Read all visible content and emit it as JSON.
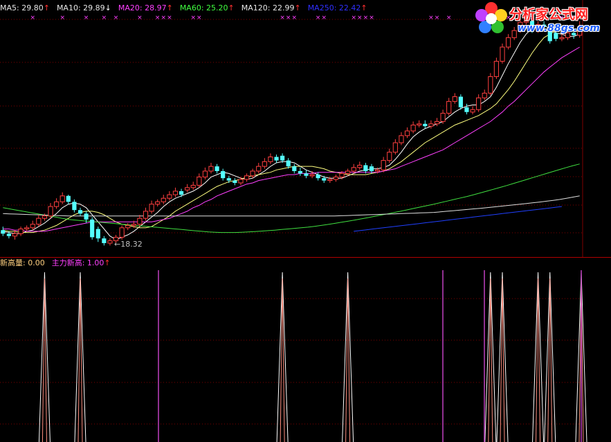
{
  "logo": {
    "title": "分析家公式网",
    "url": "www.88gs.com"
  },
  "legend_top": [
    {
      "label": "MA5: 29.80",
      "color": "#e6e6e6",
      "arrow": "↑",
      "arrow_dir": "up"
    },
    {
      "label": "MA10: 29.89",
      "color": "#e6e6e6",
      "arrow": "↓",
      "arrow_dir": "down"
    },
    {
      "label": "MA20: 28.97",
      "color": "#ff40ff",
      "arrow": "↑",
      "arrow_dir": "up"
    },
    {
      "label": "MA60: 25.20",
      "color": "#40ff40",
      "arrow": "↑",
      "arrow_dir": "up"
    },
    {
      "label": "MA120: 22.99",
      "color": "#e6e6e6",
      "arrow": "↑",
      "arrow_dir": "up"
    },
    {
      "label": "MA250: 22.42",
      "color": "#3030ff",
      "arrow": "↑",
      "arrow_dir": "up"
    }
  ],
  "legend_bottom": [
    {
      "label": "新高量: 0.00",
      "color": "#ffd080",
      "arrow": "",
      "arrow_dir": ""
    },
    {
      "label": "主力新高: 1.00",
      "color": "#ff40ff",
      "arrow": "↑",
      "arrow_dir": "up"
    }
  ],
  "low_label": "←18.32",
  "colors": {
    "up": "#ff4040",
    "down": "#54ffff",
    "ma5": "#ffffff",
    "ma10": "#ffff80",
    "ma20": "#ff40ff",
    "ma60": "#40e040",
    "ma120": "#e0e0e0",
    "ma250": "#2040ff",
    "grid": "#800000",
    "indicator_peak": "#ff9080",
    "indicator_line": "#ffffff",
    "indicator_bar": "#c040c0"
  },
  "chart_data": {
    "type": "line",
    "candles": {
      "open": [
        19.6,
        19.3,
        19.1,
        19.3,
        19.7,
        19.8,
        20.1,
        20.6,
        20.8,
        21.6,
        22.0,
        22.5,
        22.0,
        21.3,
        21.0,
        20.5,
        19.7,
        18.9,
        18.5,
        18.7,
        19.0,
        19.8,
        20.0,
        20.1,
        20.6,
        21.2,
        21.8,
        22.0,
        22.3,
        22.6,
        22.9,
        23.0,
        23.2,
        23.4,
        24.1,
        24.6,
        25.0,
        24.6,
        24.0,
        23.8,
        23.6,
        23.9,
        24.2,
        24.6,
        25.0,
        25.4,
        25.8,
        25.9,
        25.5,
        25.0,
        24.6,
        24.4,
        24.2,
        24.3,
        24.0,
        23.8,
        23.9,
        24.1,
        24.4,
        24.6,
        24.9,
        25.1,
        25.0,
        24.6,
        24.7,
        25.5,
        26.2,
        27.0,
        27.6,
        28.0,
        28.5,
        28.6,
        28.4,
        28.6,
        28.8,
        29.5,
        30.5,
        30.9,
        30.0,
        29.6,
        29.8,
        30.8,
        31.2,
        32.6,
        33.9,
        35.1,
        35.9,
        36.5,
        37.2,
        37.3,
        36.5,
        37.0,
        36.8,
        36.3,
        35.8,
        35.9,
        36.3,
        36.1
      ],
      "close": [
        19.3,
        19.1,
        19.3,
        19.7,
        19.8,
        20.1,
        20.6,
        20.8,
        21.6,
        22.0,
        22.5,
        22.0,
        21.3,
        21.0,
        20.5,
        19.0,
        18.9,
        18.5,
        18.7,
        19.0,
        19.8,
        20.0,
        20.1,
        20.6,
        21.2,
        21.8,
        22.0,
        22.3,
        22.6,
        22.9,
        22.6,
        23.2,
        23.4,
        24.1,
        24.6,
        25.0,
        24.6,
        24.0,
        23.8,
        23.6,
        23.9,
        24.2,
        24.6,
        25.0,
        25.4,
        25.8,
        25.5,
        25.5,
        25.0,
        24.6,
        24.4,
        24.2,
        24.3,
        24.0,
        23.8,
        23.9,
        24.1,
        24.4,
        24.6,
        24.9,
        25.1,
        24.6,
        24.6,
        24.7,
        25.5,
        26.2,
        27.0,
        27.6,
        28.0,
        28.5,
        28.6,
        28.4,
        28.6,
        28.8,
        29.5,
        30.5,
        30.9,
        30.0,
        29.6,
        29.8,
        30.8,
        31.2,
        32.6,
        33.9,
        35.1,
        35.9,
        36.5,
        37.2,
        37.3,
        36.5,
        37.0,
        36.8,
        35.6,
        35.8,
        35.9,
        36.3,
        36.1,
        36.8
      ],
      "high": [
        19.9,
        19.5,
        19.6,
        19.9,
        20.0,
        20.4,
        20.9,
        21.0,
        21.9,
        22.3,
        22.8,
        22.6,
        22.2,
        21.5,
        21.2,
        20.7,
        19.9,
        19.1,
        18.9,
        19.2,
        20.0,
        20.2,
        20.4,
        20.9,
        21.5,
        22.1,
        22.2,
        22.6,
        22.9,
        23.2,
        23.1,
        23.5,
        23.7,
        24.4,
        24.9,
        25.3,
        25.2,
        24.8,
        24.2,
        24.0,
        24.1,
        24.4,
        24.8,
        25.3,
        25.7,
        26.1,
        26.0,
        26.1,
        25.7,
        25.2,
        24.9,
        24.7,
        24.6,
        24.5,
        24.2,
        24.1,
        24.3,
        24.6,
        24.8,
        25.2,
        25.4,
        25.3,
        25.2,
        24.9,
        25.8,
        26.5,
        27.3,
        27.9,
        28.3,
        28.8,
        28.9,
        28.9,
        28.9,
        29.1,
        29.8,
        30.8,
        31.2,
        31.1,
        30.3,
        30.1,
        31.1,
        31.5,
        32.9,
        34.2,
        35.4,
        36.2,
        36.8,
        37.5,
        37.6,
        37.4,
        37.3,
        37.3,
        37.0,
        36.5,
        36.2,
        36.6,
        36.6,
        37.3
      ],
      "low": [
        19.1,
        18.9,
        18.8,
        19.1,
        19.5,
        19.6,
        19.9,
        20.4,
        20.6,
        21.4,
        21.8,
        21.8,
        21.1,
        20.8,
        20.2,
        18.8,
        18.6,
        18.3,
        18.3,
        18.5,
        18.8,
        19.6,
        19.8,
        19.9,
        20.4,
        21.0,
        21.6,
        21.8,
        22.1,
        22.4,
        22.4,
        22.8,
        23.0,
        23.2,
        23.9,
        24.4,
        24.4,
        23.8,
        23.6,
        23.4,
        23.4,
        23.7,
        24.0,
        24.4,
        24.8,
        25.2,
        25.3,
        25.3,
        24.8,
        24.4,
        24.2,
        24.0,
        24.0,
        23.8,
        23.6,
        23.6,
        23.7,
        23.9,
        24.2,
        24.4,
        24.7,
        24.4,
        24.4,
        24.4,
        24.5,
        25.3,
        26.0,
        26.8,
        27.4,
        27.8,
        28.3,
        28.2,
        28.2,
        28.4,
        28.6,
        29.3,
        30.3,
        29.8,
        29.4,
        29.4,
        29.6,
        30.6,
        31.0,
        32.4,
        33.7,
        34.9,
        35.7,
        36.3,
        37.0,
        36.3,
        36.3,
        36.6,
        35.4,
        35.6,
        35.6,
        35.7,
        35.8,
        35.9
      ]
    },
    "series": [
      {
        "name": "MA5",
        "values": [
          19.5,
          19.4,
          19.3,
          19.3,
          19.5,
          19.6,
          19.9,
          20.2,
          20.6,
          21.0,
          21.5,
          21.8,
          21.9,
          21.8,
          21.5,
          20.9,
          20.3,
          19.7,
          19.1,
          18.8,
          19.0,
          19.2,
          19.5,
          19.9,
          20.3,
          20.7,
          21.1,
          21.6,
          22.0,
          22.3,
          22.5,
          22.7,
          22.9,
          23.2,
          23.6,
          24.1,
          24.3,
          24.5,
          24.4,
          24.2,
          24.0,
          23.9,
          24.0,
          24.3,
          24.6,
          25.0,
          25.3,
          25.4,
          25.4,
          25.3,
          25.0,
          24.7,
          24.5,
          24.3,
          24.1,
          24.0,
          24.0,
          24.0,
          24.2,
          24.4,
          24.6,
          24.7,
          24.8,
          24.8,
          24.9,
          25.1,
          25.6,
          26.2,
          26.9,
          27.5,
          27.9,
          28.2,
          28.4,
          28.6,
          28.8,
          29.2,
          29.6,
          29.9,
          30.1,
          30.2,
          30.2,
          30.5,
          30.9,
          31.7,
          32.7,
          33.7,
          34.6,
          35.5,
          36.2,
          36.7,
          36.9,
          37.0,
          36.6,
          36.3,
          36.2,
          36.0,
          36.0,
          36.2
        ]
      },
      {
        "name": "MA10",
        "values": [
          19.6,
          19.5,
          19.5,
          19.4,
          19.4,
          19.4,
          19.5,
          19.6,
          19.8,
          20.0,
          20.3,
          20.6,
          20.9,
          21.1,
          21.2,
          21.2,
          21.1,
          20.9,
          20.6,
          20.3,
          20.1,
          20.0,
          19.9,
          19.8,
          19.8,
          19.9,
          20.2,
          20.5,
          20.8,
          21.2,
          21.5,
          21.8,
          22.1,
          22.4,
          22.7,
          23.0,
          23.3,
          23.5,
          23.7,
          23.8,
          23.9,
          24.1,
          24.2,
          24.3,
          24.4,
          24.5,
          24.7,
          24.8,
          24.9,
          25.0,
          25.0,
          25.0,
          25.0,
          24.9,
          24.8,
          24.6,
          24.5,
          24.4,
          24.3,
          24.3,
          24.3,
          24.3,
          24.4,
          24.5,
          24.6,
          24.8,
          25.1,
          25.4,
          25.8,
          26.2,
          26.6,
          27.0,
          27.3,
          27.6,
          27.9,
          28.2,
          28.5,
          28.7,
          28.9,
          29.1,
          29.3,
          29.6,
          29.9,
          30.3,
          30.9,
          31.5,
          32.2,
          33.0,
          33.8,
          34.6,
          35.3,
          35.9,
          36.2,
          36.5,
          36.6,
          36.6,
          36.5,
          36.4
        ]
      },
      {
        "name": "MA20",
        "values": [
          19.7,
          19.7,
          19.6,
          19.6,
          19.5,
          19.5,
          19.5,
          19.5,
          19.6,
          19.7,
          19.8,
          19.9,
          20.0,
          20.1,
          20.2,
          20.3,
          20.3,
          20.3,
          20.3,
          20.3,
          20.3,
          20.3,
          20.3,
          20.3,
          20.3,
          20.3,
          20.4,
          20.5,
          20.6,
          20.8,
          21.0,
          21.2,
          21.5,
          21.7,
          22.0,
          22.2,
          22.5,
          22.7,
          22.9,
          23.1,
          23.3,
          23.5,
          23.6,
          23.8,
          23.9,
          24.0,
          24.1,
          24.2,
          24.3,
          24.3,
          24.4,
          24.4,
          24.4,
          24.5,
          24.5,
          24.5,
          24.5,
          24.5,
          24.5,
          24.5,
          24.5,
          24.5,
          24.5,
          24.5,
          24.6,
          24.7,
          24.8,
          25.0,
          25.2,
          25.4,
          25.6,
          25.8,
          26.0,
          26.2,
          26.4,
          26.7,
          27.0,
          27.3,
          27.6,
          27.9,
          28.2,
          28.5,
          28.8,
          29.2,
          29.6,
          30.1,
          30.5,
          31.0,
          31.5,
          32.0,
          32.5,
          33.0,
          33.4,
          33.8,
          34.2,
          34.5,
          34.8,
          35.1
        ]
      },
      {
        "name": "MA60",
        "values": [
          21.5,
          21.4,
          21.3,
          21.2,
          21.1,
          21.0,
          20.9,
          20.8,
          20.7,
          20.6,
          20.5,
          20.45,
          20.4,
          20.35,
          20.3,
          20.25,
          20.2,
          20.15,
          20.1,
          20.05,
          20.0,
          19.95,
          19.9,
          19.85,
          19.8,
          19.75,
          19.7,
          19.65,
          19.6,
          19.55,
          19.5,
          19.45,
          19.42,
          19.4,
          19.4,
          19.4,
          19.42,
          19.45,
          19.48,
          19.52,
          19.56,
          19.6,
          19.65,
          19.7,
          19.75,
          19.8,
          19.85,
          19.92,
          20.0,
          20.08,
          20.17,
          20.26,
          20.35,
          20.45,
          20.55,
          20.65,
          20.76,
          20.87,
          20.98,
          21.09,
          21.2,
          21.32,
          21.44,
          21.56,
          21.68,
          21.8,
          21.93,
          22.06,
          22.19,
          22.32,
          22.45,
          22.6,
          22.75,
          22.9,
          23.06,
          23.22,
          23.38,
          23.55,
          23.72,
          23.89,
          24.06,
          24.23,
          24.4,
          24.57,
          24.74,
          24.9,
          25.06,
          25.2
        ]
      },
      {
        "name": "MA120",
        "values": [
          21.0,
          20.98,
          20.96,
          20.94,
          20.92,
          20.9,
          20.88,
          20.86,
          20.84,
          20.82,
          20.8,
          20.8,
          20.8,
          20.8,
          20.8,
          20.8,
          20.8,
          20.8,
          20.8,
          20.8,
          20.8,
          20.8,
          20.8,
          20.8,
          20.8,
          20.8,
          20.8,
          20.8,
          20.8,
          20.8,
          20.8,
          20.8,
          20.8,
          20.8,
          20.8,
          20.8,
          20.8,
          20.8,
          20.8,
          20.8,
          20.8,
          20.8,
          20.8,
          20.8,
          20.8,
          20.8,
          20.8,
          20.8,
          20.8,
          20.8,
          20.8,
          20.82,
          20.84,
          20.86,
          20.88,
          20.9,
          20.92,
          20.94,
          20.96,
          20.98,
          21.0,
          21.02,
          21.04,
          21.06,
          21.08,
          21.1,
          21.15,
          21.2,
          21.25,
          21.3,
          21.35,
          21.4,
          21.45,
          21.5,
          21.56,
          21.62,
          21.68,
          21.74,
          21.8,
          21.86,
          21.92,
          21.98,
          22.05,
          22.12,
          22.2,
          22.3,
          22.4,
          22.5
        ]
      },
      {
        "name": "MA250",
        "values": [
          19.5,
          19.56,
          19.62,
          19.68,
          19.74,
          19.8,
          19.86,
          19.92,
          19.98,
          20.04,
          20.1,
          20.16,
          20.22,
          20.28,
          20.34,
          20.4,
          20.46,
          20.52,
          20.58,
          20.64,
          20.7,
          20.76,
          20.82,
          20.88,
          20.94,
          21.0,
          21.06,
          21.12,
          21.18,
          21.24,
          21.3,
          21.36,
          21.42,
          21.48,
          21.54,
          21.6
        ]
      }
    ],
    "ma250_start": 59,
    "indicator": {
      "name_primary": "新高量",
      "name_secondary": "主力新高",
      "peaks": [
        7,
        13,
        47,
        58,
        82,
        92,
        100,
        84,
        90
      ],
      "bars": [
        37,
        106,
        116,
        136
      ]
    },
    "y_range": [
      17.5,
      38.5
    ],
    "annotation_low": 18.32
  }
}
